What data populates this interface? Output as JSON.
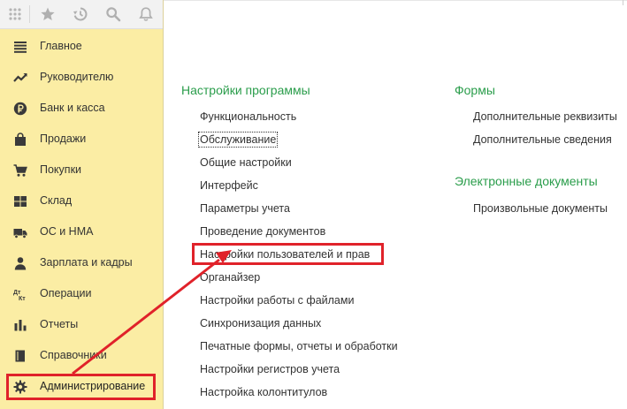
{
  "sidebar": {
    "items": [
      {
        "label": "Главное",
        "icon": "menu-lines-icon"
      },
      {
        "label": "Руководителю",
        "icon": "trend-chart-icon"
      },
      {
        "label": "Банк и касса",
        "icon": "ruble-coin-icon"
      },
      {
        "label": "Продажи",
        "icon": "shopping-bag-icon"
      },
      {
        "label": "Покупки",
        "icon": "shopping-cart-icon"
      },
      {
        "label": "Склад",
        "icon": "warehouse-grid-icon"
      },
      {
        "label": "ОС и НМА",
        "icon": "truck-icon"
      },
      {
        "label": "Зарплата и кадры",
        "icon": "person-icon"
      },
      {
        "label": "Операции",
        "icon": "debit-credit-icon"
      },
      {
        "label": "Отчеты",
        "icon": "bar-chart-icon"
      },
      {
        "label": "Справочники",
        "icon": "book-icon"
      },
      {
        "label": "Администрирование",
        "icon": "gear-icon"
      }
    ],
    "active_index": 11
  },
  "toolbar": {
    "icons": [
      "apps-grid-icon",
      "star-icon",
      "history-icon",
      "search-icon",
      "bell-icon"
    ]
  },
  "main": {
    "settings": {
      "title": "Настройки программы",
      "links": [
        "Функциональность",
        "Обслуживание",
        "Общие настройки",
        "Интерфейс",
        "Параметры учета",
        "Проведение документов",
        "Настройки пользователей и прав",
        "Органайзер",
        "Настройки работы с файлами",
        "Синхронизация данных",
        "Печатные формы, отчеты и обработки",
        "Настройки регистров учета",
        "Настройка колонтитулов"
      ]
    },
    "forms": {
      "title": "Формы",
      "links": [
        "Дополнительные реквизиты",
        "Дополнительные сведения"
      ]
    },
    "edocs": {
      "title": "Электронные документы",
      "links": [
        "Произвольные документы"
      ]
    }
  },
  "colors": {
    "sidebar_bg": "#fbeda4",
    "section_title": "#2a9d4b",
    "highlight": "#e0222a"
  }
}
